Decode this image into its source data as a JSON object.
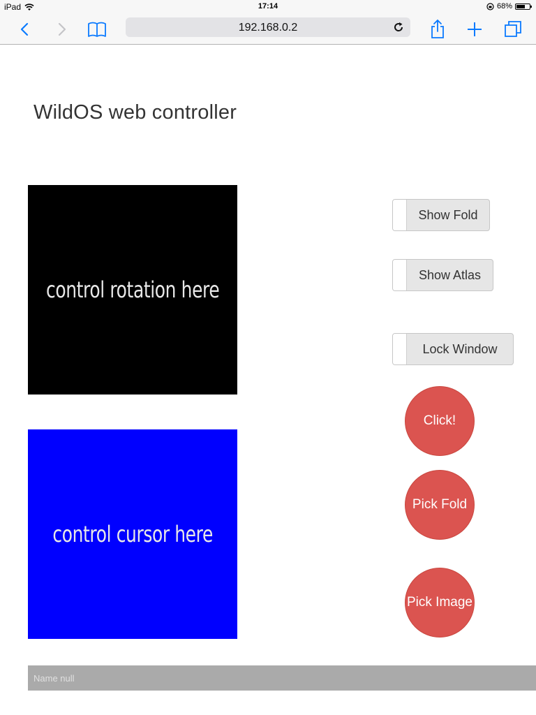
{
  "status_bar": {
    "device": "iPad",
    "time": "17:14",
    "battery_percent_label": "68%",
    "battery_level": 0.68,
    "icons": [
      "wifi-icon",
      "orientation-lock-icon",
      "battery-icon"
    ]
  },
  "browser": {
    "url": "192.168.0.2",
    "icons": [
      "back-icon",
      "forward-icon",
      "bookmarks-icon",
      "reload-icon",
      "share-icon",
      "new-tab-icon",
      "tabs-icon"
    ],
    "accent_color": "#0a7aff"
  },
  "page": {
    "title": "WildOS web controller",
    "rotation_pad": {
      "label": "control rotation here",
      "color": "#000000"
    },
    "cursor_pad": {
      "label": "control cursor here",
      "color": "#0000ff"
    },
    "toggles": [
      {
        "label": "Show Fold",
        "on": false
      },
      {
        "label": "Show Atlas",
        "on": false
      },
      {
        "label": "Lock Window",
        "on": false
      }
    ],
    "buttons": [
      {
        "label": "Click!"
      },
      {
        "label": "Pick Fold"
      },
      {
        "label": "Pick Image"
      }
    ],
    "button_color": "#db5450",
    "status_text": "Name null"
  }
}
